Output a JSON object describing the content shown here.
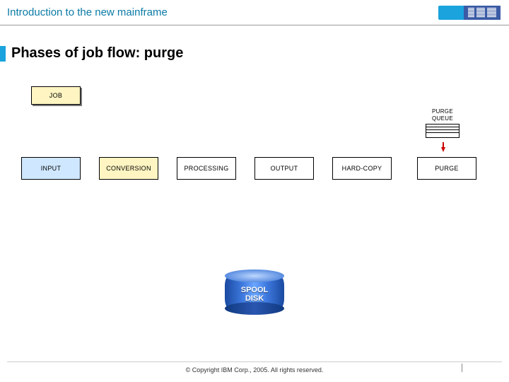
{
  "header": {
    "title": "Introduction to the new mainframe",
    "logo_text": "IBM"
  },
  "slide": {
    "title": "Phases of job flow: purge"
  },
  "diagram": {
    "job_box": "JOB",
    "queue": {
      "line1": "PURGE",
      "line2": "QUEUE"
    },
    "phases": {
      "input": "INPUT",
      "conversion": "CONVERSION",
      "processing": "PROCESSING",
      "output": "OUTPUT",
      "hardcopy": "HARD-COPY",
      "purge": "PURGE"
    },
    "spool": {
      "line1": "SPOOL",
      "line2": "DISK"
    }
  },
  "footer": {
    "copyright": "© Copyright IBM Corp., 2005. All rights reserved."
  }
}
